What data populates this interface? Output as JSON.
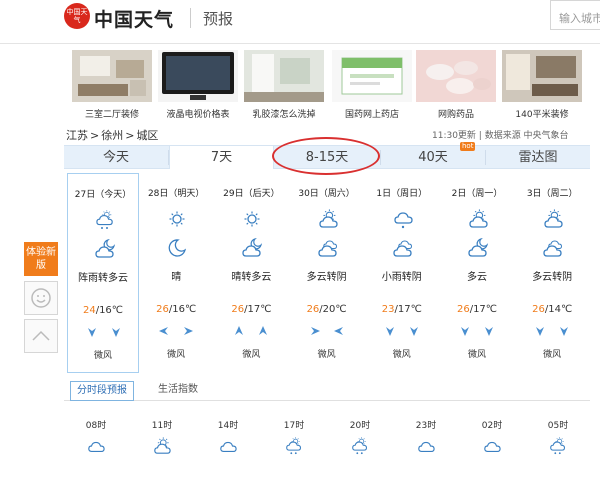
{
  "header": {
    "logo_badge": "中国天气",
    "logo_text": "中国天气",
    "logo_sub": "预报",
    "search_placeholder": "输入城市"
  },
  "ads": [
    {
      "label": "三室二厅装修",
      "icon": "living-room-photo"
    },
    {
      "label": "液晶电视价格表",
      "icon": "tv-photo"
    },
    {
      "label": "乳胶漆怎么洗掉",
      "icon": "room-photo"
    },
    {
      "label": "国药网上药店",
      "icon": "medicine-box-photo"
    },
    {
      "label": "网购药品",
      "icon": "pills-photo"
    },
    {
      "label": "140平米装修",
      "icon": "apartment-photo"
    }
  ],
  "breadcrumb": [
    "江苏",
    ">",
    "徐州",
    ">",
    "城区"
  ],
  "update": "11:30更新 | 数据来源 中央气象台",
  "tabs": [
    {
      "label": "今天"
    },
    {
      "label": "7天"
    },
    {
      "label": "8-15天"
    },
    {
      "label": "40天"
    },
    {
      "label": "雷达图"
    }
  ],
  "hot_badge": "hot",
  "forecast": [
    {
      "date": "27日（今天）",
      "desc": "阵雨转多云",
      "hi": "24",
      "lo": "/16℃",
      "wind": "微风",
      "day_icon": "shower-icon",
      "night_icon": "cloudy-night-icon",
      "arrows": [
        "down",
        "down"
      ]
    },
    {
      "date": "28日（明天）",
      "desc": "晴",
      "hi": "26",
      "lo": "/16℃",
      "wind": "微风",
      "day_icon": "sunny-icon",
      "night_icon": "moon-icon",
      "arrows": [
        "left",
        "right"
      ]
    },
    {
      "date": "29日（后天）",
      "desc": "晴转多云",
      "hi": "26",
      "lo": "/17℃",
      "wind": "微风",
      "day_icon": "sunny-icon",
      "night_icon": "cloudy-night-icon",
      "arrows": [
        "up",
        "up"
      ]
    },
    {
      "date": "30日（周六）",
      "desc": "多云转阴",
      "hi": "26",
      "lo": "/20℃",
      "wind": "微风",
      "day_icon": "partly-cloudy-icon",
      "night_icon": "overcast-icon",
      "arrows": [
        "right",
        "left"
      ]
    },
    {
      "date": "1日（周日）",
      "desc": "小雨转阴",
      "hi": "23",
      "lo": "/17℃",
      "wind": "微风",
      "day_icon": "light-rain-icon",
      "night_icon": "overcast-icon",
      "arrows": [
        "down",
        "down"
      ]
    },
    {
      "date": "2日（周一）",
      "desc": "多云",
      "hi": "26",
      "lo": "/17℃",
      "wind": "微风",
      "day_icon": "partly-cloudy-icon",
      "night_icon": "cloudy-night-icon",
      "arrows": [
        "down",
        "down"
      ]
    },
    {
      "date": "3日（周二）",
      "desc": "多云转阴",
      "hi": "26",
      "lo": "/14℃",
      "wind": "微风",
      "day_icon": "partly-cloudy-icon",
      "night_icon": "overcast-icon",
      "arrows": [
        "down",
        "down"
      ]
    }
  ],
  "side": {
    "new_version": "体验新版",
    "smile_icon": "smile-icon",
    "top_icon": "back-to-top-icon"
  },
  "subtabs": [
    {
      "label": "分时段预报"
    },
    {
      "label": "生活指数"
    }
  ],
  "hourly": [
    {
      "time": "08时",
      "icon": "cloudy-icon"
    },
    {
      "time": "11时",
      "icon": "partly-cloudy-icon"
    },
    {
      "time": "14时",
      "icon": "cloudy-icon"
    },
    {
      "time": "17时",
      "icon": "shower-icon"
    },
    {
      "time": "20时",
      "icon": "shower-icon"
    },
    {
      "time": "23时",
      "icon": "cloudy-icon"
    },
    {
      "time": "02时",
      "icon": "cloudy-icon"
    },
    {
      "time": "05时",
      "icon": "shower-icon"
    }
  ],
  "colors": {
    "accent": "#f07c1b",
    "tab_bg": "#e6f0fa",
    "highlight_circle": "#d93030",
    "icon_blue": "#3a7fc1"
  }
}
